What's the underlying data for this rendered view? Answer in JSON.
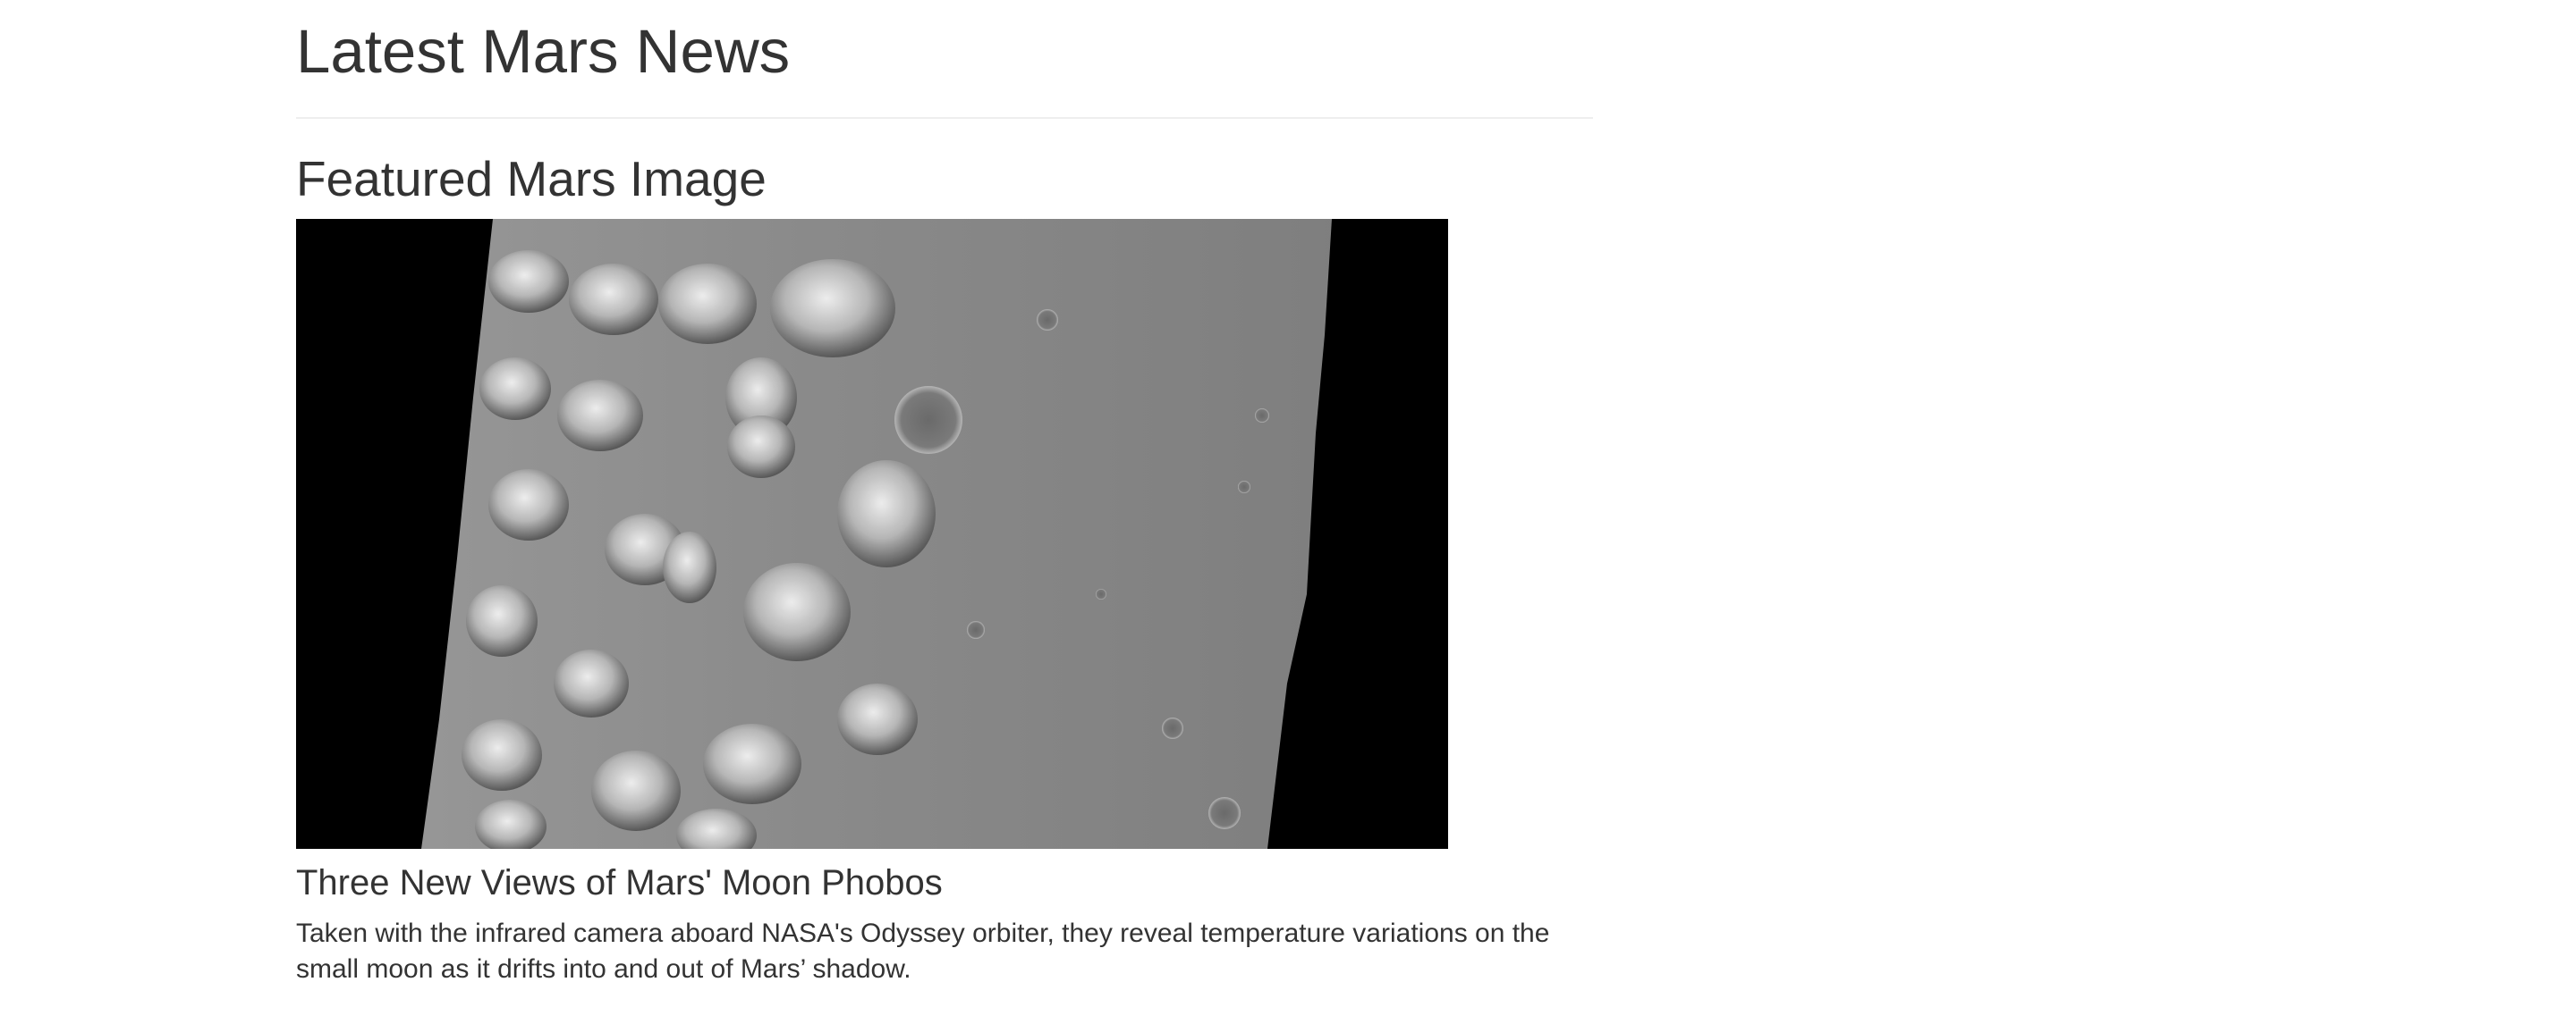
{
  "page": {
    "title": "Latest Mars News"
  },
  "featured_image": {
    "heading": "Featured Mars Image",
    "image_name": "mars-surface-image"
  },
  "news": {
    "title": "Three New Views of Mars' Moon Phobos",
    "teaser": "Taken with the infrared camera aboard NASA's Odyssey orbiter, they reveal temperature variations on the small moon as it drifts into and out of Mars’ shadow."
  }
}
